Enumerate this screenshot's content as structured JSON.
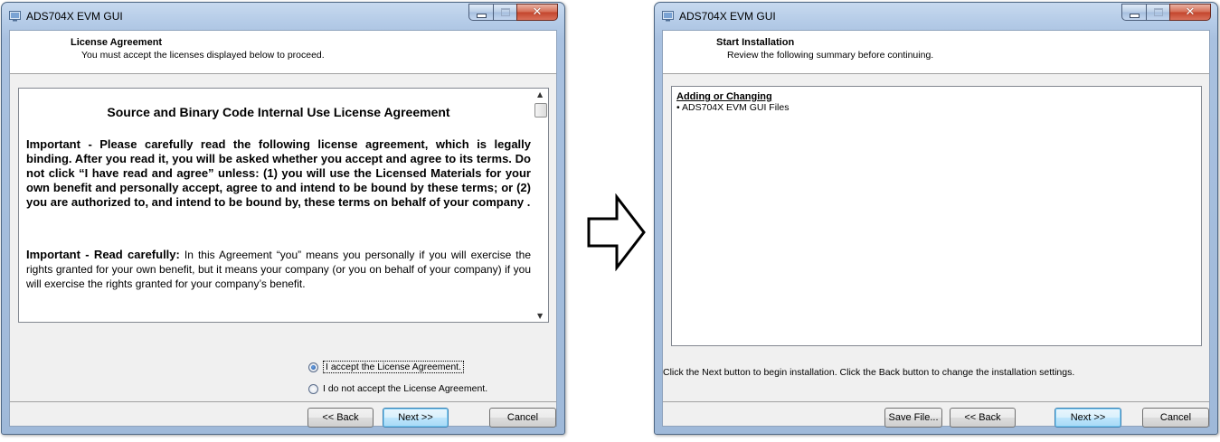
{
  "left_window": {
    "title": "ADS704X EVM GUI",
    "header_title": "License Agreement",
    "header_subtitle": "You must accept the licenses displayed below to proceed.",
    "license_heading": "Source and Binary Code Internal Use License Agreement",
    "license_para1": "Important - Please carefully read the following license agreement, which is legally binding.  After you read it, you will be asked whether you accept and agree to its terms.  Do not click  “I have read and agree” unless: (1) you will use the Licensed Materials for your own benefit and personally accept, agree to and intend to be bound by these terms; or (2) you are authorized to,  and intend to be bound by, these terms on behalf of your company .",
    "license_para2_bold": "Important - Read carefully:",
    "license_para2_rest": " In this Agreement “you” means you personally if you will exercise the rights granted for your own benefit, but it means your company (or you on behalf of your company) if you will exercise the rights granted for your company’s benefit.",
    "radio_accept": "I accept the License Agreement.",
    "radio_decline": "I do not accept the License Agreement.",
    "radio_selected": "accept",
    "back_label": "<< Back",
    "next_label": "Next >>",
    "cancel_label": "Cancel"
  },
  "right_window": {
    "title": "ADS704X EVM GUI",
    "header_title": "Start Installation",
    "header_subtitle": "Review the following summary before continuing.",
    "summary_title": "Adding or Changing",
    "summary_item": "• ADS704X EVM GUI Files",
    "instruction": "Click the Next button to begin installation.  Click the Back button to change the installation settings.",
    "save_label": "Save File...",
    "back_label": "<< Back",
    "next_label": "Next >>",
    "cancel_label": "Cancel"
  },
  "colors": {
    "window_frame": "#b4cbe7",
    "close_button": "#c3442b",
    "client_bg": "#f0f0f0"
  }
}
